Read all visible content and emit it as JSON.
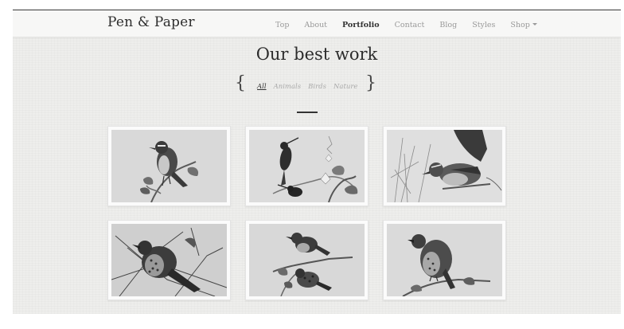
{
  "brand": "Pen & Paper",
  "nav": {
    "items": [
      {
        "label": "Top",
        "active": false
      },
      {
        "label": "About",
        "active": false
      },
      {
        "label": "Portfolio",
        "active": true
      },
      {
        "label": "Contact",
        "active": false
      },
      {
        "label": "Blog",
        "active": false
      },
      {
        "label": "Styles",
        "active": false
      },
      {
        "label": "Shop",
        "active": false,
        "dropdown": true
      }
    ]
  },
  "portfolio": {
    "title": "Our best work",
    "brace_open": "{",
    "brace_close": "}",
    "filters": [
      {
        "label": "All",
        "active": true
      },
      {
        "label": "Animals",
        "active": false
      },
      {
        "label": "Birds",
        "active": false
      },
      {
        "label": "Nature",
        "active": false
      }
    ]
  },
  "icons": {
    "dropdown": "chevron-down-icon"
  },
  "colors": {
    "background": "#eeeeec",
    "navbar": "#f7f7f6",
    "text_dark": "#2e2e2e",
    "text_muted": "#999999"
  }
}
